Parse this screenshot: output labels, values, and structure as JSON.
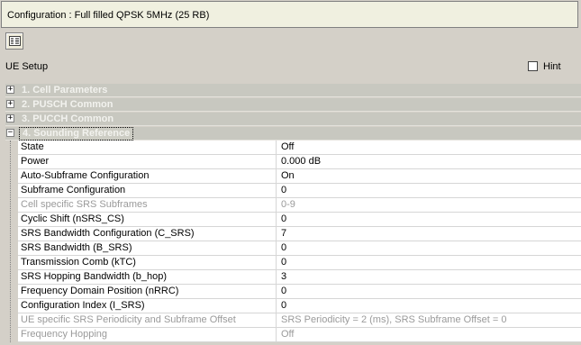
{
  "window": {
    "config_title": "Configuration : Full filled QPSK 5MHz (25 RB)"
  },
  "toolbar": {
    "button_icon": "view-list-icon"
  },
  "panel": {
    "title": "UE Setup",
    "hint_label": "Hint",
    "hint_checked": false
  },
  "sections": [
    {
      "label": "1. Cell Parameters",
      "expanded": false
    },
    {
      "label": "2. PUSCH Common",
      "expanded": false
    },
    {
      "label": "3. PUCCH Common",
      "expanded": false
    },
    {
      "label": "4. Sounding Reference",
      "expanded": true
    }
  ],
  "rows": [
    {
      "name": "State",
      "value": "Off",
      "disabled": false
    },
    {
      "name": "Power",
      "value": "0.000 dB",
      "disabled": false
    },
    {
      "name": "Auto-Subframe Configuration",
      "value": "On",
      "disabled": false
    },
    {
      "name": "Subframe Configuration",
      "value": "0",
      "disabled": false
    },
    {
      "name": "Cell specific SRS Subframes",
      "value": "0-9",
      "disabled": true
    },
    {
      "name": "Cyclic Shift (nSRS_CS)",
      "value": "0",
      "disabled": false
    },
    {
      "name": "SRS Bandwidth Configuration (C_SRS)",
      "value": "7",
      "disabled": false
    },
    {
      "name": "SRS Bandwidth (B_SRS)",
      "value": "0",
      "disabled": false
    },
    {
      "name": "Transmission Comb (kTC)",
      "value": "0",
      "disabled": false
    },
    {
      "name": "SRS Hopping Bandwidth (b_hop)",
      "value": "3",
      "disabled": false
    },
    {
      "name": "Frequency Domain Position (nRRC)",
      "value": "0",
      "disabled": false
    },
    {
      "name": "Configuration Index (I_SRS)",
      "value": "0",
      "disabled": false
    },
    {
      "name": "UE specific SRS Periodicity and Subframe Offset",
      "value": "SRS Periodicity = 2 (ms), SRS Subframe Offset = 0",
      "disabled": true
    },
    {
      "name": "Frequency Hopping",
      "value": "Off",
      "disabled": true
    }
  ]
}
